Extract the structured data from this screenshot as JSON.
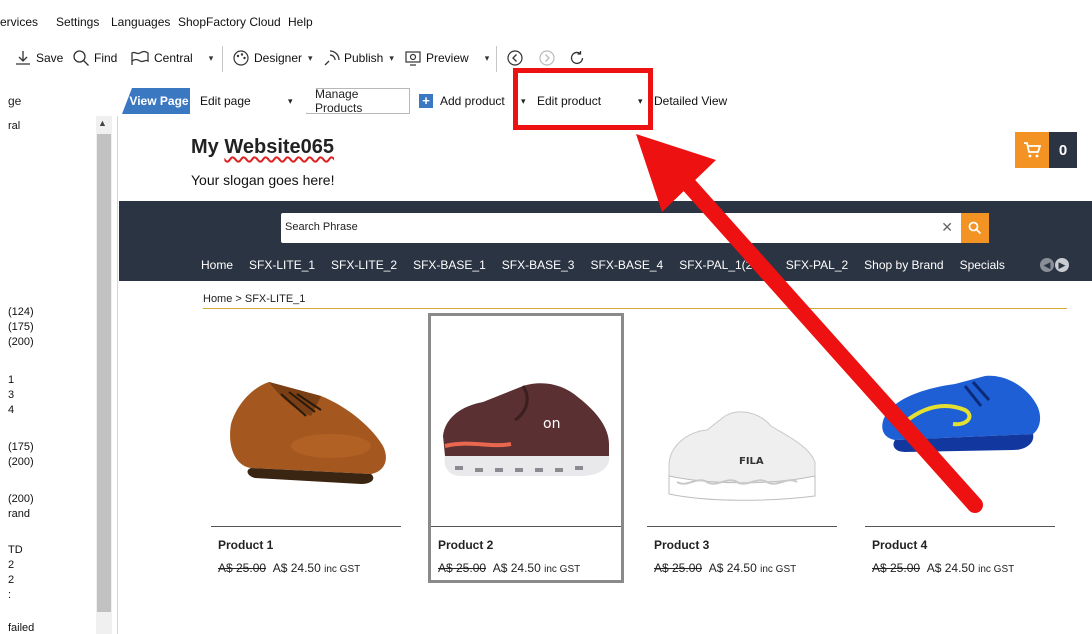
{
  "menu": {
    "items": [
      "ervices",
      "Settings",
      "Languages",
      "ShopFactory Cloud",
      "Help"
    ]
  },
  "toolbar": {
    "save": "Save",
    "find": "Find",
    "central": "Central",
    "designer": "Designer",
    "publish": "Publish",
    "preview": "Preview"
  },
  "tabs": {
    "left_label": "ge",
    "view_page": "View Page",
    "edit_page": "Edit page",
    "manage_products": "Manage Products",
    "add_product": "Add product",
    "edit_product": "Edit product",
    "detailed_view": "Detailed View"
  },
  "tree": {
    "items": [
      "ral",
      "(124)",
      "(175)",
      "(200)",
      "1",
      "3",
      "4",
      "(175)",
      "(200)",
      "(200)",
      "rand",
      "TD",
      "2",
      "2",
      ":",
      "failed"
    ]
  },
  "site": {
    "title_prefix": "My ",
    "title_word": "Website065",
    "slogan": "Your slogan goes here!",
    "cart_count": "0",
    "search_placeholder": "Search Phrase",
    "search_clear": "✕",
    "nav": [
      "Home",
      "SFX-LITE_1",
      "SFX-LITE_2",
      "SFX-BASE_1",
      "SFX-BASE_3",
      "SFX-BASE_4",
      "SFX-PAL_1(200)",
      "SFX-PAL_2",
      "Shop by Brand",
      "Specials"
    ],
    "breadcrumb": "Home  >  SFX-LITE_1"
  },
  "products": [
    {
      "name": "Product 1",
      "old_price": "A$ 25.00",
      "new_price": "A$ 24.50",
      "tax": "inc GST"
    },
    {
      "name": "Product 2",
      "old_price": "A$ 25.00",
      "new_price": "A$ 24.50",
      "tax": "inc GST"
    },
    {
      "name": "Product 3",
      "old_price": "A$ 25.00",
      "new_price": "A$ 24.50",
      "tax": "inc GST"
    },
    {
      "name": "Product 4",
      "old_price": "A$ 25.00",
      "new_price": "A$ 24.50",
      "tax": "inc GST"
    }
  ],
  "colors": {
    "accent_orange": "#f39323",
    "nav_dark": "#2b3442",
    "tab_blue": "#3a78c2",
    "annotation_red": "#ee1111"
  }
}
